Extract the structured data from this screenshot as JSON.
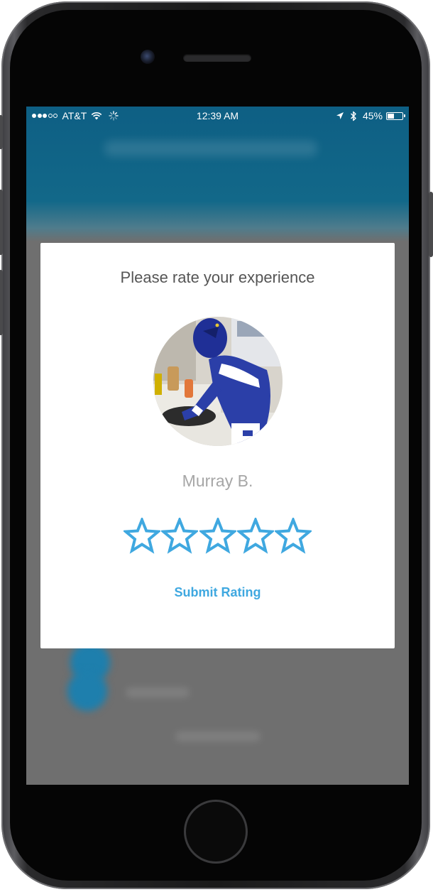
{
  "status_bar": {
    "carrier": "AT&T",
    "time": "12:39 AM",
    "battery_percent": "45%",
    "battery_level": 0.45,
    "signal_bars_filled": 3,
    "signal_bars_total": 5
  },
  "rating_dialog": {
    "title": "Please rate your experience",
    "user_name": "Murray B.",
    "star_count": 5,
    "selected_stars": 0,
    "submit_label": "Submit Rating"
  },
  "colors": {
    "header_blue": "#0e5f84",
    "accent_blue": "#3fa8e0",
    "overlay_gray": "#6f6f6f"
  },
  "icons": [
    "wifi-icon",
    "loading-icon",
    "location-arrow-icon",
    "bluetooth-icon",
    "battery-icon",
    "star-icon"
  ]
}
